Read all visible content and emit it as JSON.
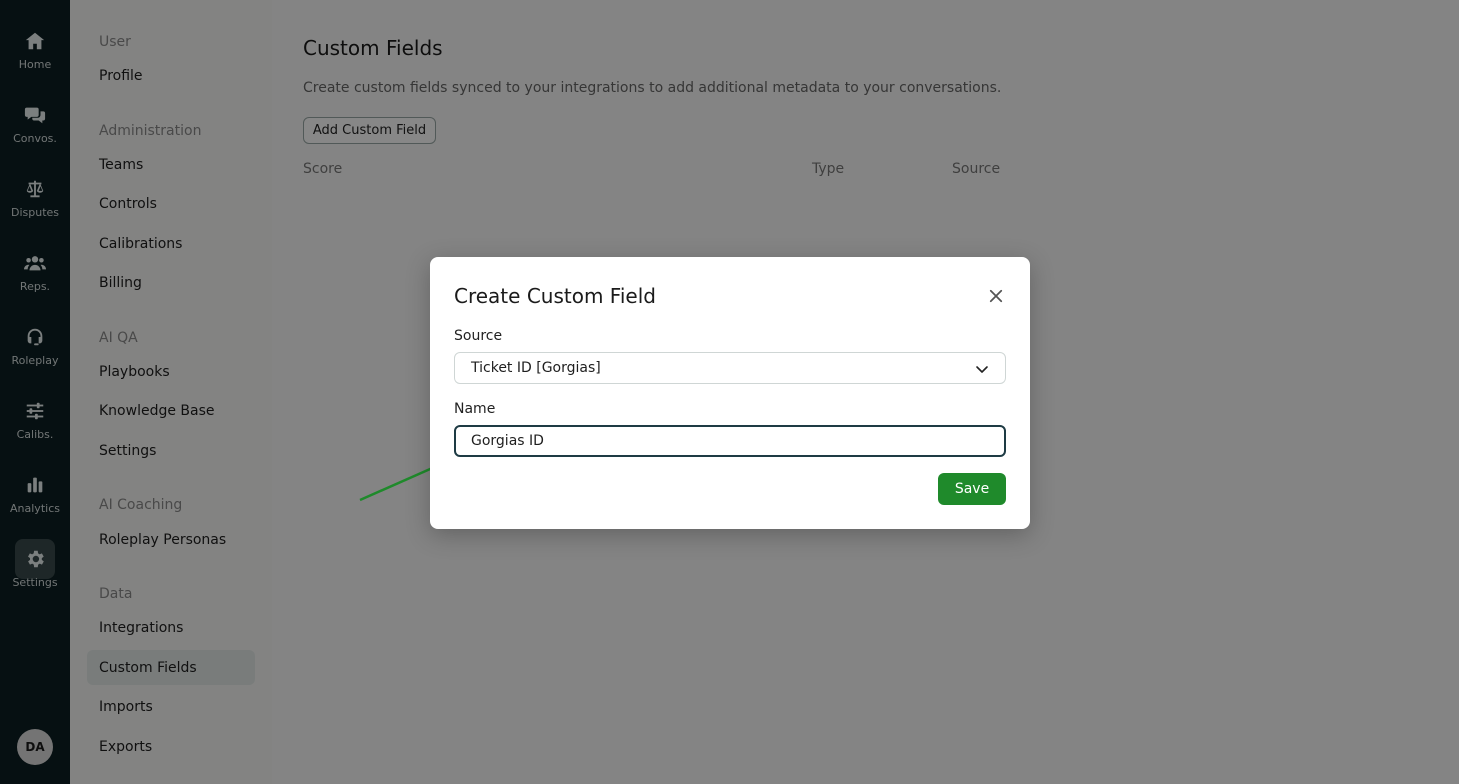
{
  "rail": {
    "items": [
      {
        "label": "Home",
        "icon": "home-icon"
      },
      {
        "label": "Convos.",
        "icon": "chat-bubbles-icon"
      },
      {
        "label": "Disputes",
        "icon": "scales-icon"
      },
      {
        "label": "Reps.",
        "icon": "people-icon"
      },
      {
        "label": "Roleplay",
        "icon": "headset-icon"
      },
      {
        "label": "Calibs.",
        "icon": "sliders-icon"
      },
      {
        "label": "Analytics",
        "icon": "bar-chart-icon"
      },
      {
        "label": "Settings",
        "icon": "gear-icon",
        "active": true
      }
    ],
    "avatar_initials": "DA"
  },
  "sidebar": {
    "sections": [
      {
        "title": "User",
        "items": [
          "Profile"
        ]
      },
      {
        "title": "Administration",
        "items": [
          "Teams",
          "Controls",
          "Calibrations",
          "Billing"
        ]
      },
      {
        "title": "AI QA",
        "items": [
          "Playbooks",
          "Knowledge Base",
          "Settings"
        ]
      },
      {
        "title": "AI Coaching",
        "items": [
          "Roleplay Personas"
        ]
      },
      {
        "title": "Data",
        "items": [
          "Integrations",
          "Custom Fields",
          "Imports",
          "Exports"
        ]
      }
    ],
    "active_item": "Custom Fields"
  },
  "main": {
    "title": "Custom Fields",
    "description": "Create custom fields synced to your integrations to add additional metadata to your conversations.",
    "add_button": "Add Custom Field",
    "table_headers": [
      "Score",
      "Type",
      "Source"
    ]
  },
  "modal": {
    "title": "Create Custom Field",
    "source_label": "Source",
    "source_value": "Ticket ID [Gorgias]",
    "name_label": "Name",
    "name_value": "Gorgias ID",
    "save_label": "Save"
  },
  "colors": {
    "rail_bg": "#0c1f22",
    "save_button": "#1f8a2b",
    "annotation_arrow": "#1f8a2b"
  }
}
